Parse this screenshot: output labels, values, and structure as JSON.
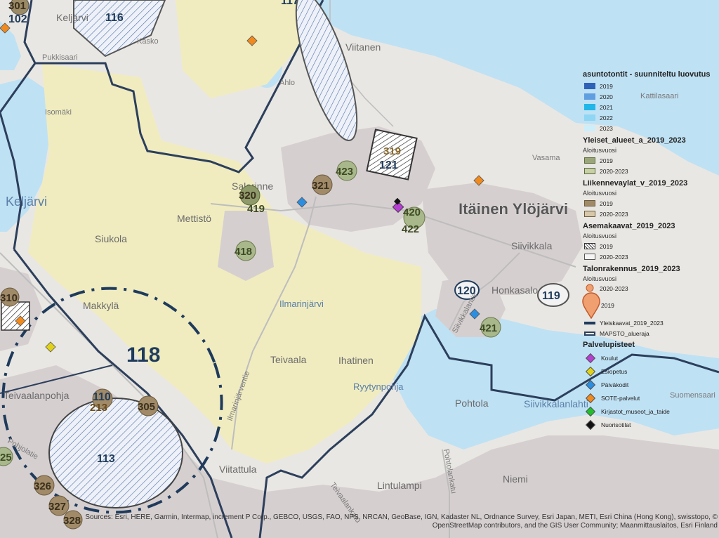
{
  "colors": {
    "water": "#bfe1f4",
    "land": "#e9e7e3",
    "forest": "#f0ecc0",
    "urban": "#d6cfd0",
    "district_line": "#2c3f5c",
    "plan_fill": "#b6ae8e",
    "general_area_fill": "#8a9a6a"
  },
  "map": {
    "place_labels": [
      "Keljärvi",
      "Pukkisaari",
      "Kasko",
      "Viitanen",
      "Isomäki",
      "Kattilasaari",
      "Salorinne",
      "Mettistö",
      "Siukola",
      "Siivikkala",
      "Honkasalo",
      "Makkylä",
      "Teivaala",
      "Ihatinen",
      "Pohtola",
      "Viitattula",
      "Lintulampi",
      "Niemi",
      "Suomensaari",
      "Vasama",
      "Ahlo"
    ],
    "water_labels": [
      "Keljärvi",
      "Ilmarinjärvi",
      "Ryytynpohja",
      "Siivikkalanlahti"
    ],
    "road_labels": [
      "Ilmarinjärventie",
      "Siivikkalantie",
      "Pohtolankatu",
      "Teivaalanpohja",
      "Pohjolatie",
      "Teivaalankatu"
    ],
    "area_title": "Itäinen Ylöjärvi",
    "big_area_number": "118",
    "hatched_numbers": [
      "116",
      "117",
      "113"
    ],
    "site_numbers": [
      "301",
      "102",
      "319",
      "121",
      "423",
      "321",
      "320",
      "419",
      "420",
      "422",
      "418",
      "310",
      "120",
      "119",
      "421",
      "110",
      "213",
      "305",
      "25",
      "326",
      "327",
      "328"
    ]
  },
  "legend": {
    "title_1": "asuntotontit - suunniteltu luovutus",
    "years_1": [
      {
        "label": "2019",
        "color": "#2e62b8"
      },
      {
        "label": "2020",
        "color": "#5f9ee0"
      },
      {
        "label": "2021",
        "color": "#20b6e8"
      },
      {
        "label": "2022",
        "color": "#8ed6f3"
      },
      {
        "label": "2023",
        "color": "#cdeefb"
      }
    ],
    "title_2": "Yleiset_alueet_a_2019_2023",
    "sub_2": "Aloitusvuosi",
    "rows_2": [
      "2019",
      "2020-2023"
    ],
    "title_3": "Liikennevaylat_v_2019_2023",
    "sub_3": "Aloitusvuosi",
    "rows_3": [
      "2019",
      "2020-2023"
    ],
    "title_4": "Asemakaavat_2019_2023",
    "sub_4": "Aloitusvuosi",
    "rows_4": [
      "2019",
      "2020-2023"
    ],
    "title_5": "Talonrakennus_2019_2023",
    "sub_5": "Aloitusvuosi",
    "rows_5": [
      "2020-2023",
      "2019"
    ],
    "row_6": "Yleiskaavat_2019_2023",
    "row_7": "MAPSTO_alueraja",
    "title_8": "Palvelupisteet",
    "services": [
      {
        "label": "Koulut",
        "color": "#b43fd0"
      },
      {
        "label": "Esiopetus",
        "color": "#e0d21a"
      },
      {
        "label": "Päiväkodit",
        "color": "#2c8ee0"
      },
      {
        "label": "SOTE-palvelut",
        "color": "#f08a1e"
      },
      {
        "label": "Kirjastot_museot_ja_taide",
        "color": "#22c02a"
      },
      {
        "label": "Nuorisotilat",
        "color": "#111111"
      }
    ]
  },
  "attribution": {
    "line1": "Sources: Esri, HERE, Garmin, Intermap, increment P Corp., GEBCO, USGS, FAO, NPS, NRCAN, GeoBase, IGN, Kadaster NL, Ordnance Survey, Esri Japan, METI, Esri China (Hong Kong), swisstopo, ©",
    "line2": "OpenStreetMap contributors, and the GIS User Community; Maanmittauslaitos, Esri Finland"
  }
}
